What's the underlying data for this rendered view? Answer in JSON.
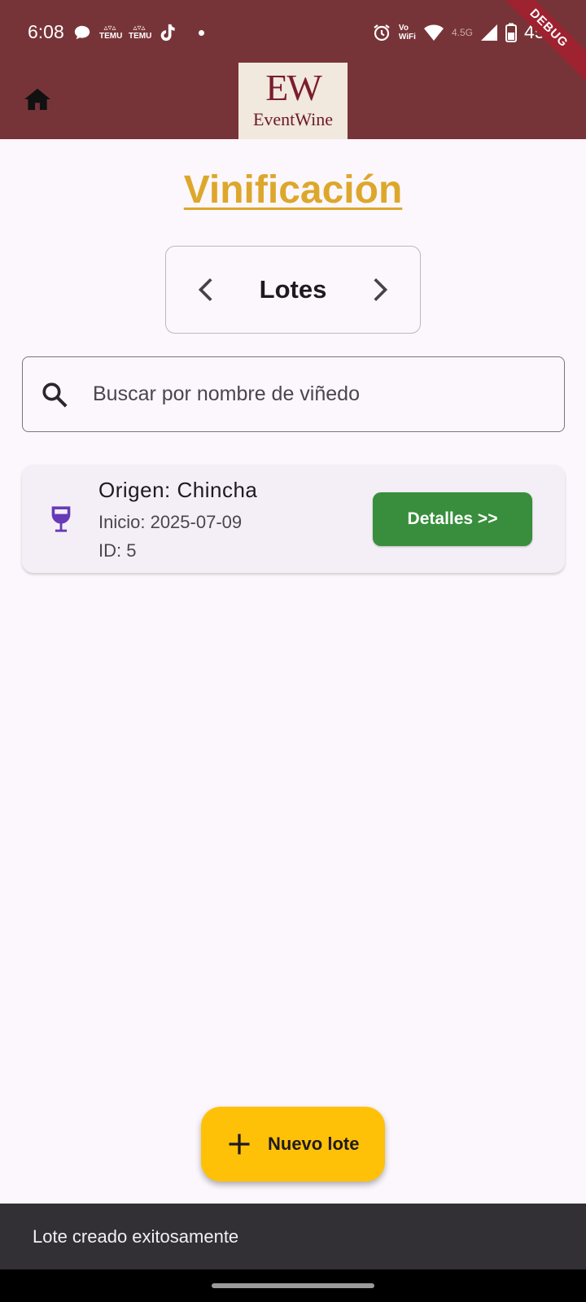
{
  "status_bar": {
    "time": "6:08",
    "temu_label": "TEMU",
    "vowifi_top": "Vo",
    "vowifi_bottom": "WiFi",
    "network": "4.5G",
    "battery": "45%"
  },
  "debug_banner": "DEBUG",
  "app_bar": {
    "logo_mark": "EW",
    "logo_name": "EventWine",
    "home_icon": "home-icon"
  },
  "page": {
    "title": "Vinificación",
    "section_selector": {
      "label": "Lotes",
      "prev_icon": "chevron-left-icon",
      "next_icon": "chevron-right-icon"
    },
    "search": {
      "placeholder": "Buscar por nombre de viñedo",
      "icon": "search-icon"
    }
  },
  "lots": [
    {
      "origin": "Origen: Chincha",
      "start": "Inicio: 2025-07-09",
      "id": "ID: 5",
      "icon": "wine-glass-icon",
      "button_label": "Detalles >>"
    }
  ],
  "fab": {
    "label": "Nuevo lote",
    "icon": "plus-icon"
  },
  "snackbar": {
    "message": "Lote creado exitosamente"
  },
  "colors": {
    "app_bar": "#773438",
    "title": "#DDA72B",
    "details_button": "#388E3C",
    "fab": "#FFC107",
    "wine_icon": "#673AB7"
  }
}
